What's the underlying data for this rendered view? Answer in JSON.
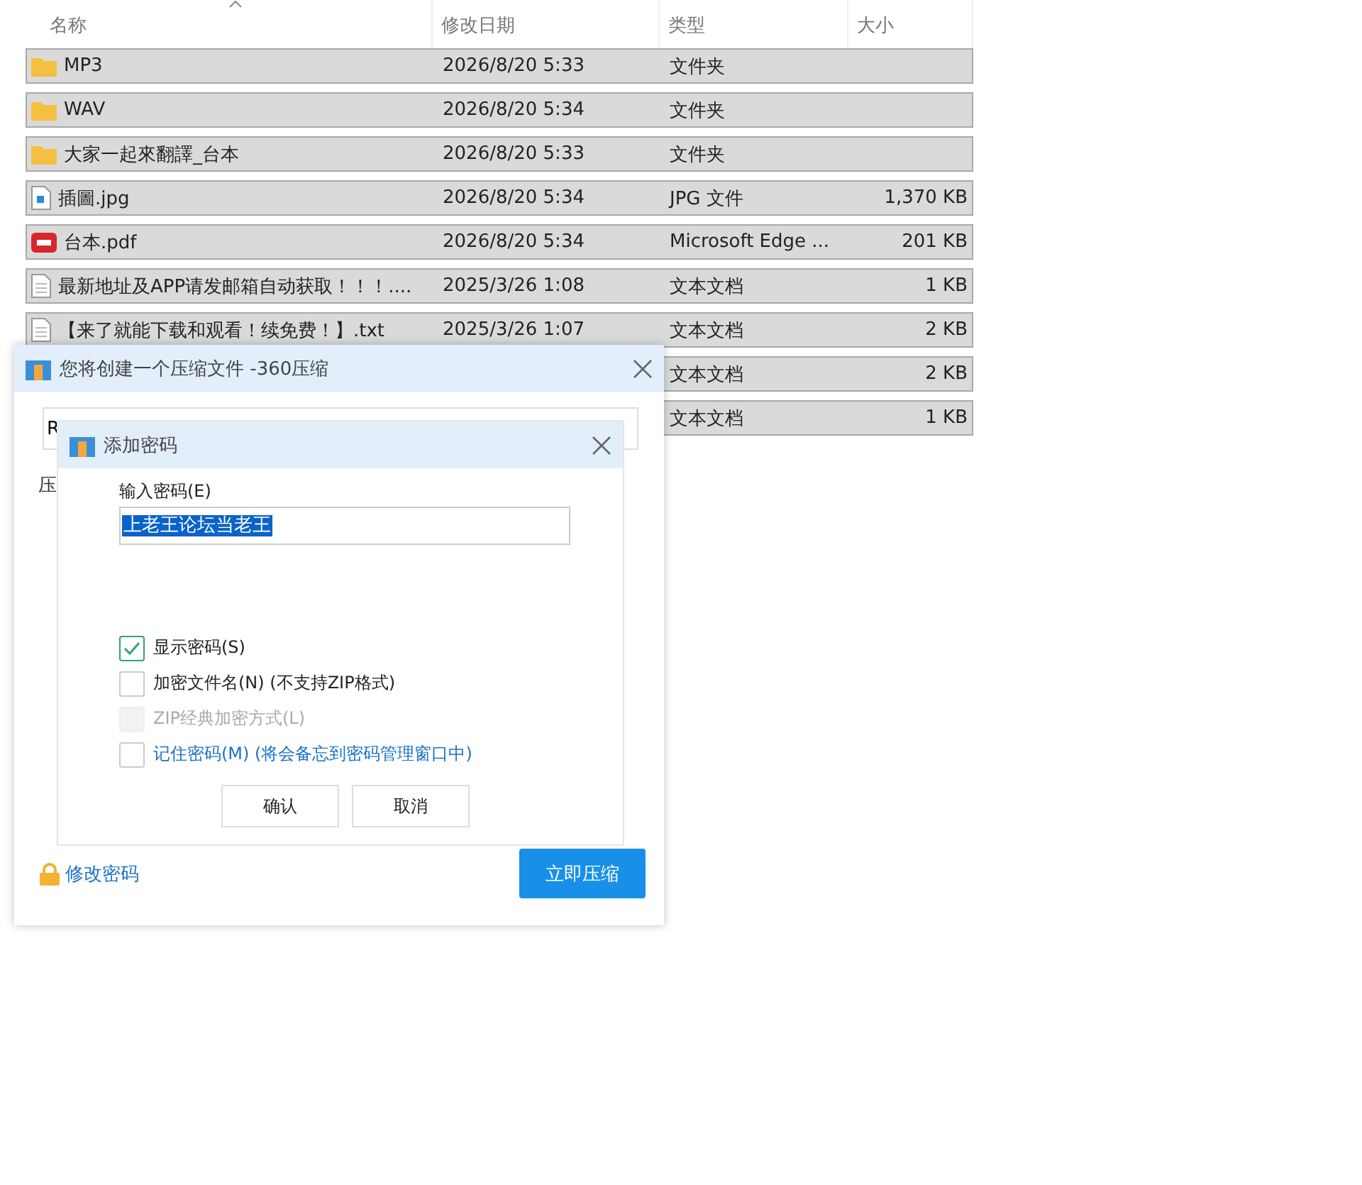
{
  "file_list": {
    "columns": [
      {
        "label": "名称",
        "sorted": true
      },
      {
        "label": "修改日期",
        "sorted": false
      },
      {
        "label": "类型",
        "sorted": false
      },
      {
        "label": "大小",
        "sorted": false
      }
    ],
    "rows": [
      {
        "kind": "folder",
        "name": "MP3",
        "date": "2026/8/20 5:33",
        "type": "文件夹",
        "selected": true
      },
      {
        "kind": "folder",
        "name": "WAV",
        "date": "2026/8/20 5:34",
        "type": "文件夹",
        "selected": true
      },
      {
        "kind": "folder",
        "name": "大家一起來翻譯_台本",
        "date": "2026/8/20 5:33",
        "type": "文件夹",
        "selected": true
      },
      {
        "kind": "image",
        "name": "插圖.jpg",
        "date": "2026/8/20 5:34",
        "type": "JPG 文件",
        "size": "1,370 KB",
        "selected": true
      },
      {
        "kind": "pdf",
        "name": "台本.pdf",
        "date": "2026/8/20 5:34",
        "type": "Microsoft Edge ...",
        "size": "201 KB",
        "selected": true
      },
      {
        "kind": "text",
        "name": "最新地址及APP请发邮箱自动获取！！！....",
        "date": "2025/3/26 1:08",
        "type": "文本文档",
        "size": "1 KB",
        "selected": true
      },
      {
        "kind": "text",
        "name": "【来了就能下载和观看！续免费！】.txt",
        "date": "2025/3/26 1:07",
        "type": "文本文档",
        "size": "2 KB",
        "selected": true
      },
      {
        "type": "文本文档",
        "size": "2 KB",
        "selected": true
      },
      {
        "type": "文本文档",
        "size": "1 KB",
        "selected": true
      }
    ]
  },
  "archive_dialog": {
    "title": "您将创建一个压缩文件 -360压缩",
    "path_value": "R",
    "label": "压",
    "change_password_link": "修改密码",
    "compress_button": "立即压缩"
  },
  "password_dialog": {
    "title": "添加密码",
    "field_label": "输入密码(E)",
    "password": "上老王论坛当老王",
    "options": [
      {
        "label": "显示密码(S)",
        "checked": true,
        "disabled": false,
        "link": false
      },
      {
        "label": "加密文件名(N) (不支持ZIP格式)",
        "checked": false,
        "disabled": false,
        "link": false
      },
      {
        "label": "ZIP经典加密方式(L)",
        "checked": false,
        "disabled": true,
        "link": false
      },
      {
        "label": "记住密码(M) (将会备忘到密码管理窗口中)",
        "checked": false,
        "disabled": false,
        "link": true
      }
    ],
    "buttons": [
      "确认",
      "取消"
    ]
  }
}
